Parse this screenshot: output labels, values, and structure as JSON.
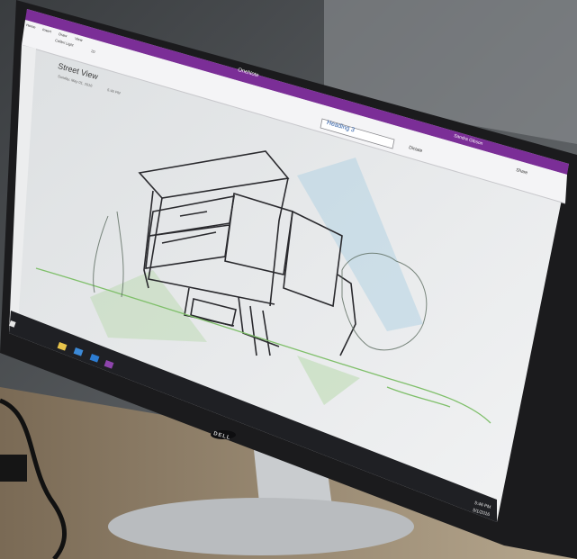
{
  "onenote": {
    "app_title": "OneNote",
    "user": "Sandra Gibson",
    "ribbon_tabs": [
      "Home",
      "Insert",
      "Draw",
      "View"
    ],
    "font_name": "Calibri Light",
    "font_size": "20",
    "style_dropdown": "Heading 3",
    "dictate_label": "Dictate",
    "share_label": "Share"
  },
  "page": {
    "title": "Street View",
    "date": "Sunday, May 01, 2016",
    "time": "5:46 PM"
  },
  "taskbar": {
    "clock_time": "5:46 PM",
    "clock_date": "5/1/2016"
  },
  "monitor": {
    "brand": "DELL"
  },
  "colors": {
    "onenote_purple": "#7b2e97",
    "screen_bg": "#e9ebec",
    "sketch_ink": "#2a2a2e",
    "sketch_green": "#7fbf6a",
    "sketch_blue": "#a9cfe3"
  }
}
